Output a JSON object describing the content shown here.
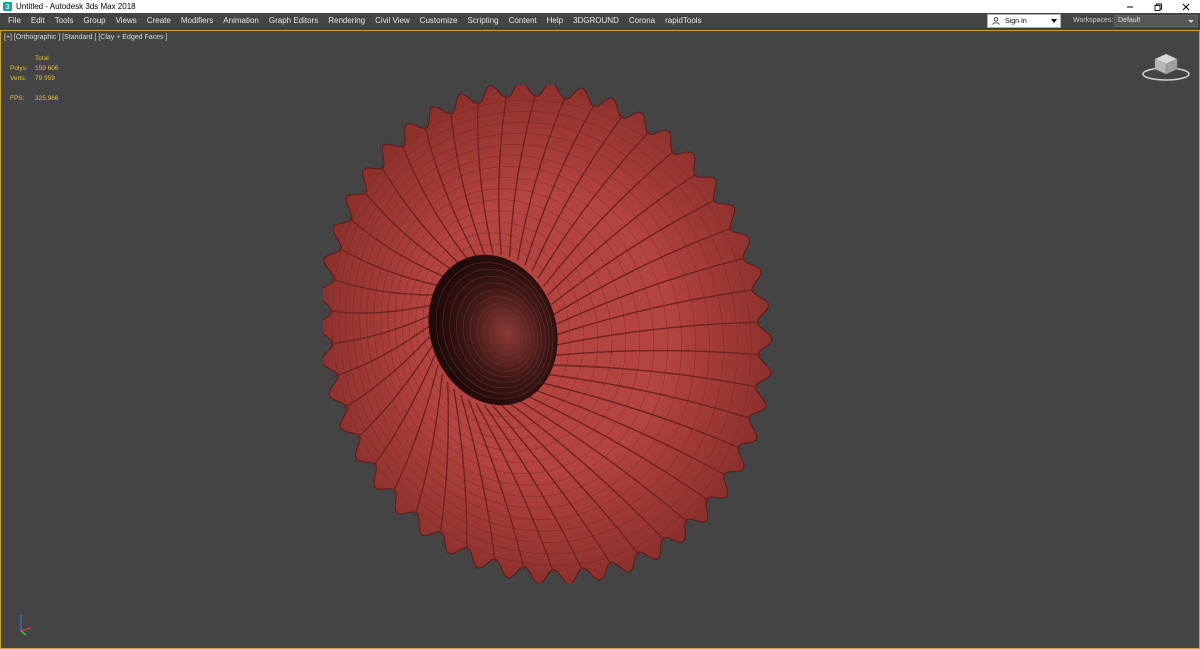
{
  "window": {
    "title": "Untitled - Autodesk 3ds Max 2018",
    "app_icon": "3dsmax-icon",
    "controls": [
      "minimize-icon",
      "restore-icon",
      "close-icon"
    ]
  },
  "menubar": {
    "items": [
      "File",
      "Edit",
      "Tools",
      "Group",
      "Views",
      "Create",
      "Modifiers",
      "Animation",
      "Graph Editors",
      "Rendering",
      "Civil View",
      "Customize",
      "Scripting",
      "Content",
      "Help",
      "3DGROUND",
      "Corona",
      "rapidTools"
    ],
    "sign_in": {
      "label": "Sign In",
      "icon": "user-icon"
    },
    "workspaces": {
      "label": "Workspaces:",
      "value": "Default"
    }
  },
  "viewport": {
    "label": "[+] [Orthographic ] [Standard ] [Clay + Edged Faces ]",
    "stats": {
      "header": "Total",
      "polys_label": "Polys:",
      "polys_value": "159 606",
      "verts_label": "Verts:",
      "verts_value": "79 959",
      "fps_label": "FPS:",
      "fps_value": "325,966"
    },
    "object_color": "#9b3a36",
    "highlight_color": "#c24a45"
  },
  "colors": {
    "viewport_bg": "#444444",
    "active_border": "#c9a428",
    "stats_text": "#e2c233"
  }
}
